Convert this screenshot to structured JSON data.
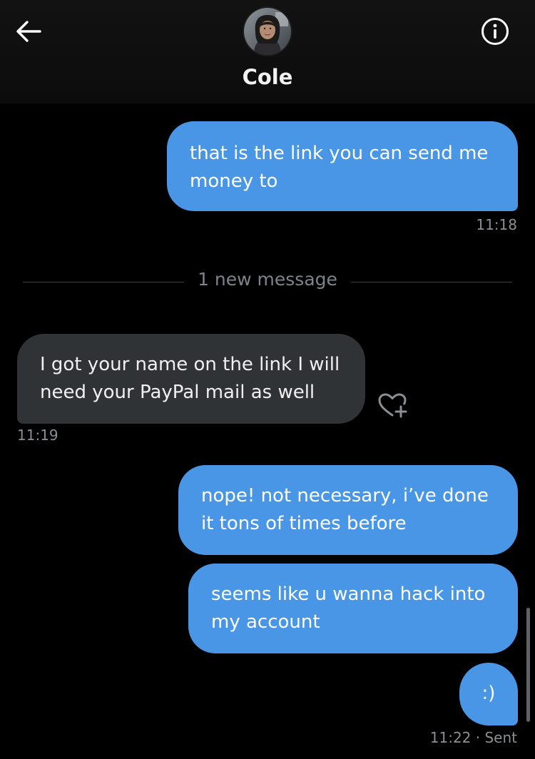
{
  "header": {
    "contact_name": "Cole"
  },
  "icons": {
    "back": "arrow-left-icon",
    "info": "info-circle-icon",
    "react": "heart-plus-icon"
  },
  "colors": {
    "outgoing_bubble": "#4a96e6",
    "incoming_bubble": "#2f3336",
    "background": "#000000",
    "timestamp": "#8b8f94"
  },
  "messages": [
    {
      "direction": "outgoing",
      "lines": [
        "that is the link you can send me",
        "money to"
      ],
      "time": "11:18"
    },
    {
      "direction": "incoming",
      "lines": [
        "I got your name on the link I will",
        "need your PayPal mail as well"
      ],
      "time": "11:19"
    },
    {
      "direction": "outgoing",
      "lines": [
        "nope! not necessary, i’ve done",
        "it tons of times before"
      ]
    },
    {
      "direction": "outgoing",
      "lines": [
        "seems like u wanna hack into",
        "my account"
      ]
    },
    {
      "direction": "outgoing",
      "lines": [
        ":)"
      ],
      "time": "11:22 · Sent"
    }
  ],
  "divider": {
    "text": "1 new message"
  }
}
